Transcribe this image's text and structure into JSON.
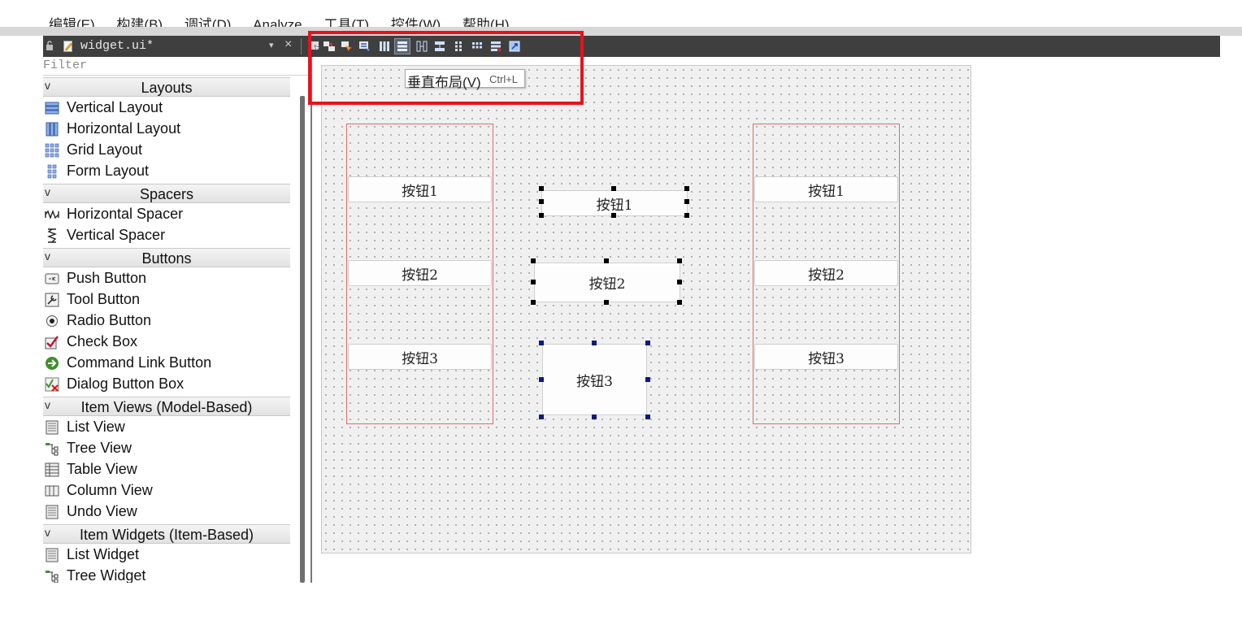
{
  "menu": {
    "items": [
      "编辑(E)",
      "构建(B)",
      "调试(D)",
      "Analyze",
      "工具(T)",
      "控件(W)",
      "帮助(H)"
    ]
  },
  "tab": {
    "title": "widget.ui*",
    "close_glyph": "×",
    "dropdown_glyph": "▾"
  },
  "toolbar": {
    "icons": [
      "edit-widgets-icon",
      "edit-signals-slots-icon",
      "edit-buddies-icon",
      "edit-tab-order-icon",
      "horizontal-layout-icon",
      "vertical-layout-icon",
      "horizontal-splitter-icon",
      "vertical-splitter-icon",
      "form-layout-icon",
      "grid-layout-icon",
      "break-layout-icon",
      "adjust-size-icon"
    ],
    "active": "vertical-layout-icon"
  },
  "tooltip": {
    "label": "垂直布局(V)",
    "shortcut": "Ctrl+L"
  },
  "filter": {
    "placeholder": "Filter"
  },
  "widget_box": {
    "chevron": "v",
    "layouts": {
      "title": "Layouts",
      "items": [
        "Vertical Layout",
        "Horizontal Layout",
        "Grid Layout",
        "Form Layout"
      ]
    },
    "spacers": {
      "title": "Spacers",
      "items": [
        "Horizontal Spacer",
        "Vertical Spacer"
      ]
    },
    "buttons": {
      "title": "Buttons",
      "items": [
        "Push Button",
        "Tool Button",
        "Radio Button",
        "Check Box",
        "Command Link Button",
        "Dialog Button Box"
      ]
    },
    "item_views": {
      "title": "Item Views (Model-Based)",
      "items": [
        "List View",
        "Tree View",
        "Table View",
        "Column View",
        "Undo View"
      ]
    },
    "item_widgets": {
      "title": "Item Widgets (Item-Based)",
      "items": [
        "List Widget",
        "Tree Widget"
      ]
    }
  },
  "form": {
    "left_layout": [
      "按钮1",
      "按钮2",
      "按钮3"
    ],
    "middle": [
      "按钮1",
      "按钮2",
      "按钮3"
    ],
    "right_layout": [
      "按钮1",
      "按钮2",
      "按钮3"
    ]
  },
  "colors": {
    "highlight": "#e8121b",
    "layout_border": "#e06a6a",
    "tab_bar": "#3f3f40"
  }
}
